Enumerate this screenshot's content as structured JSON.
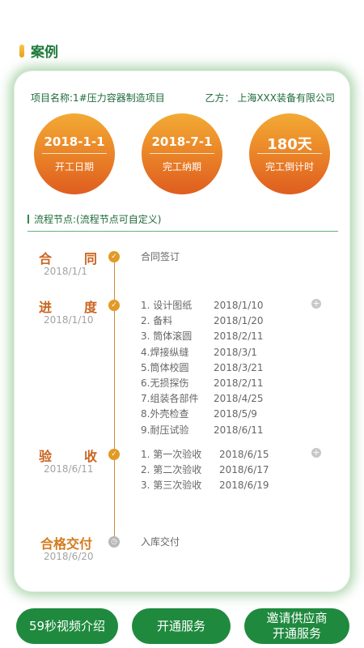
{
  "section": {
    "title": "案例"
  },
  "project": {
    "name": "项目名称:1#压力容器制造项目",
    "party_b": "乙方： 上海XXX装备有限公司"
  },
  "milestones": [
    {
      "value": "2018-1-1",
      "label": "开工日期"
    },
    {
      "value": "2018-7-1",
      "label": "完工纳期"
    },
    {
      "value": "180天",
      "label": "完工倒计时"
    }
  ],
  "flow": {
    "title": "流程节点:(流程节点可自定义)"
  },
  "nodes": [
    {
      "name": [
        "合",
        "同"
      ],
      "date": "2018/1/1",
      "status": "done",
      "steps": [
        {
          "text": "合同签订",
          "date": ""
        }
      ]
    },
    {
      "name": [
        "进",
        "度"
      ],
      "date": "2018/1/10",
      "status": "done",
      "steps": [
        {
          "text": "1. 设计图纸",
          "date": "2018/1/10"
        },
        {
          "text": "2. 备料",
          "date": "2018/1/20"
        },
        {
          "text": "3. 筒体滚圆",
          "date": "2018/2/11"
        },
        {
          "text": "4.焊接纵缝",
          "date": "2018/3/1"
        },
        {
          "text": "5.筒体校圆",
          "date": "2018/3/21"
        },
        {
          "text": "6.无损探伤",
          "date": "2018/2/11"
        },
        {
          "text": "7.组装各部件",
          "date": "2018/4/25"
        },
        {
          "text": "8.外壳检查",
          "date": "2018/5/9"
        },
        {
          "text": "9.耐压试验",
          "date": "2018/6/11"
        }
      ]
    },
    {
      "name": [
        "验",
        "收"
      ],
      "date": "2018/6/11",
      "status": "done",
      "steps": [
        {
          "text": "1. 第一次验收",
          "date": "2018/6/15"
        },
        {
          "text": "2. 第二次验收",
          "date": "2018/6/17"
        },
        {
          "text": "3. 第三次验收",
          "date": "2018/6/19"
        }
      ]
    },
    {
      "name": [
        "合格交付"
      ],
      "date": "2018/6/20",
      "status": "pending",
      "steps": [
        {
          "text": "入库交付",
          "date": ""
        }
      ]
    }
  ],
  "buttons": {
    "video": "59秒视频介绍",
    "open": "开通服务",
    "invite_line1": "邀请供应商",
    "invite_line2": "开通服务"
  },
  "colors": {
    "brand_green": "#1f8a3e",
    "accent_orange": "#e29a26"
  }
}
